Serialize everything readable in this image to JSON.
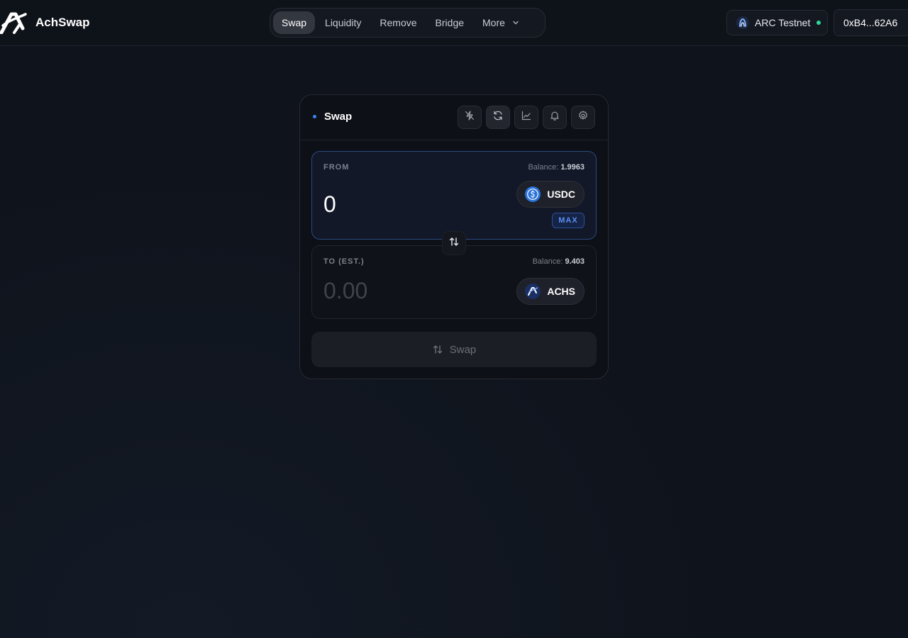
{
  "brand": {
    "name": "AchSwap",
    "logo_icon": "achswap-logo-icon"
  },
  "nav": {
    "items": [
      {
        "label": "Swap",
        "active": true
      },
      {
        "label": "Liquidity",
        "active": false
      },
      {
        "label": "Remove",
        "active": false
      },
      {
        "label": "Bridge",
        "active": false
      },
      {
        "label": "More",
        "active": false,
        "icon": "chevron-down-icon"
      }
    ]
  },
  "network": {
    "label": "ARC Testnet",
    "status_color": "#34d399"
  },
  "wallet": {
    "address": "0xB4...62A6"
  },
  "swap_card": {
    "title": "Swap",
    "accent": "#3b82f6",
    "tools": [
      "no-flash-icon",
      "refresh-icon",
      "chart-icon",
      "bell-icon",
      "gear-icon"
    ],
    "from": {
      "label": "FROM",
      "balance_label": "Balance:",
      "balance_value": "1.9963",
      "amount": "0",
      "token": "USDC",
      "max_label": "MAX"
    },
    "to": {
      "label": "TO (EST.)",
      "balance_label": "Balance:",
      "balance_value": "9.403",
      "amount": "0.00",
      "token": "ACHS"
    },
    "submit_label": "Swap"
  }
}
